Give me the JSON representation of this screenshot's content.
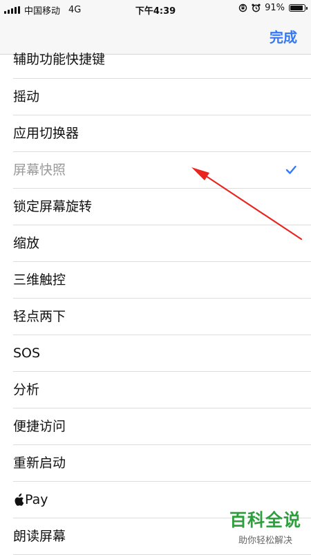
{
  "status_bar": {
    "carrier": "中国移动",
    "network": "4G",
    "time": "下午4:39",
    "battery_percent": "91%",
    "battery_level": 0.91
  },
  "nav": {
    "done_label": "完成"
  },
  "items": [
    {
      "label": "辅助功能快捷键"
    },
    {
      "label": "摇动"
    },
    {
      "label": "应用切换器"
    },
    {
      "label": "屏幕快照",
      "selected": true
    },
    {
      "label": "锁定屏幕旋转"
    },
    {
      "label": "缩放"
    },
    {
      "label": "三维触控"
    },
    {
      "label": "轻点两下"
    },
    {
      "label": "SOS"
    },
    {
      "label": "分析"
    },
    {
      "label": "便捷访问"
    },
    {
      "label": "重新启动"
    },
    {
      "label": "Pay"
    },
    {
      "label": "朗读屏幕"
    }
  ],
  "watermark": {
    "title": "百科全说",
    "subtitle": "助你轻松解决"
  },
  "colors": {
    "accent": "#3478f6",
    "annotation": "#e8251f",
    "watermark": "#2f9e3f"
  }
}
